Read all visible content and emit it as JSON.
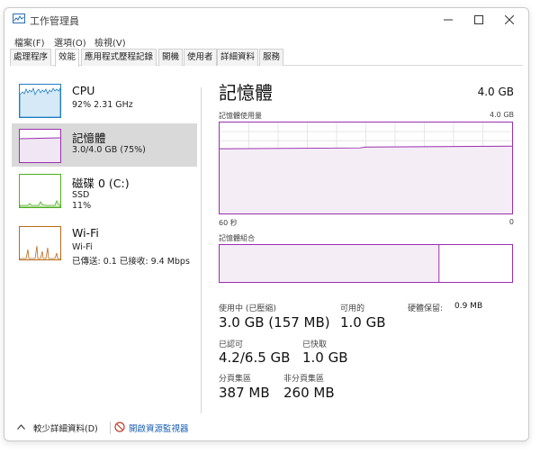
{
  "window": {
    "title": "工作管理員"
  },
  "menu": {
    "items": [
      "檔案(F)",
      "選項(O)",
      "檢視(V)"
    ]
  },
  "tabs": [
    "處理程序",
    "效能",
    "應用程式歷程記錄",
    "開機",
    "使用者",
    "詳細資料",
    "服務"
  ],
  "sidebar": {
    "items": [
      {
        "title": "CPU",
        "sub1": "92% 2.31 GHz",
        "sub2": ""
      },
      {
        "title": "記憶體",
        "sub1": "3.0/4.0 GB (75%)",
        "sub2": ""
      },
      {
        "title": "磁碟 0 (C:)",
        "sub1": "SSD",
        "sub2": "11%"
      },
      {
        "title": "Wi-Fi",
        "sub1": "Wi-Fi",
        "sub2": "已傳送: 0.1 已接收: 9.4 Mbps"
      }
    ]
  },
  "main": {
    "title": "記憶體",
    "capacity": "4.0 GB",
    "usage_label": "記憶體使用量",
    "usage_max": "4.0 GB",
    "time_left": "60 秒",
    "time_right": "0",
    "composition_label": "記憶體組合",
    "composition_used_fraction": 0.75,
    "usage_fraction": 0.75
  },
  "stats": {
    "in_use_label": "使用中 (已壓縮)",
    "in_use_value": "3.0 GB (157 MB)",
    "available_label": "可用的",
    "available_value": "1.0 GB",
    "hw_reserved_label": "硬體保留:",
    "hw_reserved_value": "0.9 MB",
    "committed_label": "已認可",
    "committed_value": "4.2/6.5 GB",
    "cached_label": "已快取",
    "cached_value": "1.0 GB",
    "paged_label": "分頁集區",
    "paged_value": "387 MB",
    "nonpaged_label": "非分頁集區",
    "nonpaged_value": "260 MB"
  },
  "footer": {
    "fewer_details": "較少詳細資料(D)",
    "resource_monitor": "開啟資源監視器"
  },
  "colors": {
    "memory": "#9b2fae",
    "cpu": "#1f7fc4",
    "disk": "#4caf1f",
    "wifi": "#b86a1a"
  }
}
